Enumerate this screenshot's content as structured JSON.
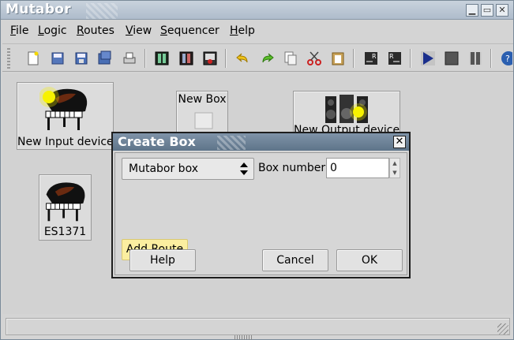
{
  "window": {
    "title": "Mutabor"
  },
  "menubar": {
    "items": [
      "File",
      "Logic",
      "Routes",
      "View",
      "Sequencer",
      "Help"
    ],
    "mnemonics": [
      "F",
      "L",
      "R",
      "V",
      "S",
      "H"
    ]
  },
  "workspace": {
    "devices": [
      {
        "label": "New Input device",
        "icon": "grand-piano-icon"
      },
      {
        "label": "ES1371",
        "icon": "grand-piano-icon"
      },
      {
        "label": "New Box",
        "icon": "box-icon"
      },
      {
        "label": "New Output device",
        "icon": "speakers-icon"
      }
    ]
  },
  "dialog": {
    "title": "Create Box",
    "box_type": "Mutabor box",
    "box_number_label": "Box number",
    "box_number_value": "0",
    "add_route_label": "Add Route",
    "help_label": "Help",
    "cancel_label": "Cancel",
    "ok_label": "OK"
  },
  "colors": {
    "dialog_title": "#5e7489",
    "add_route_bg": "#fbeea0",
    "toolbar_play": "#1a2f8c"
  }
}
